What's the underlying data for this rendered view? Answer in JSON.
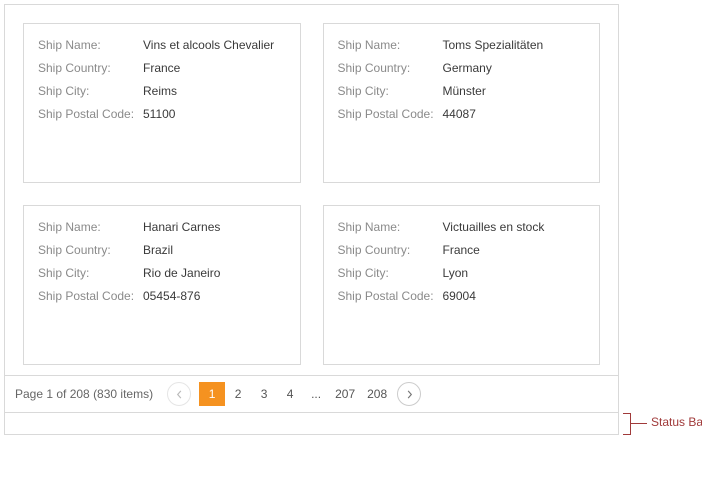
{
  "labels": {
    "shipName": "Ship Name:",
    "shipCountry": "Ship Country:",
    "shipCity": "Ship City:",
    "shipPostalCode": "Ship Postal Code:"
  },
  "cards": [
    {
      "name": "Vins et alcools Chevalier",
      "country": "France",
      "city": "Reims",
      "postal": "51100"
    },
    {
      "name": "Toms Spezialitäten",
      "country": "Germany",
      "city": "Münster",
      "postal": "44087"
    },
    {
      "name": "Hanari Carnes",
      "country": "Brazil",
      "city": "Rio de Janeiro",
      "postal": "05454-876"
    },
    {
      "name": "Victuailles en stock",
      "country": "France",
      "city": "Lyon",
      "postal": "69004"
    }
  ],
  "pagination": {
    "info": "Page 1 of 208 (830 items)",
    "pages": [
      "1",
      "2",
      "3",
      "4",
      "...",
      "207",
      "208"
    ],
    "currentIndex": 0,
    "prevDisabled": true,
    "nextDisabled": false
  },
  "callout": "Status Bar"
}
